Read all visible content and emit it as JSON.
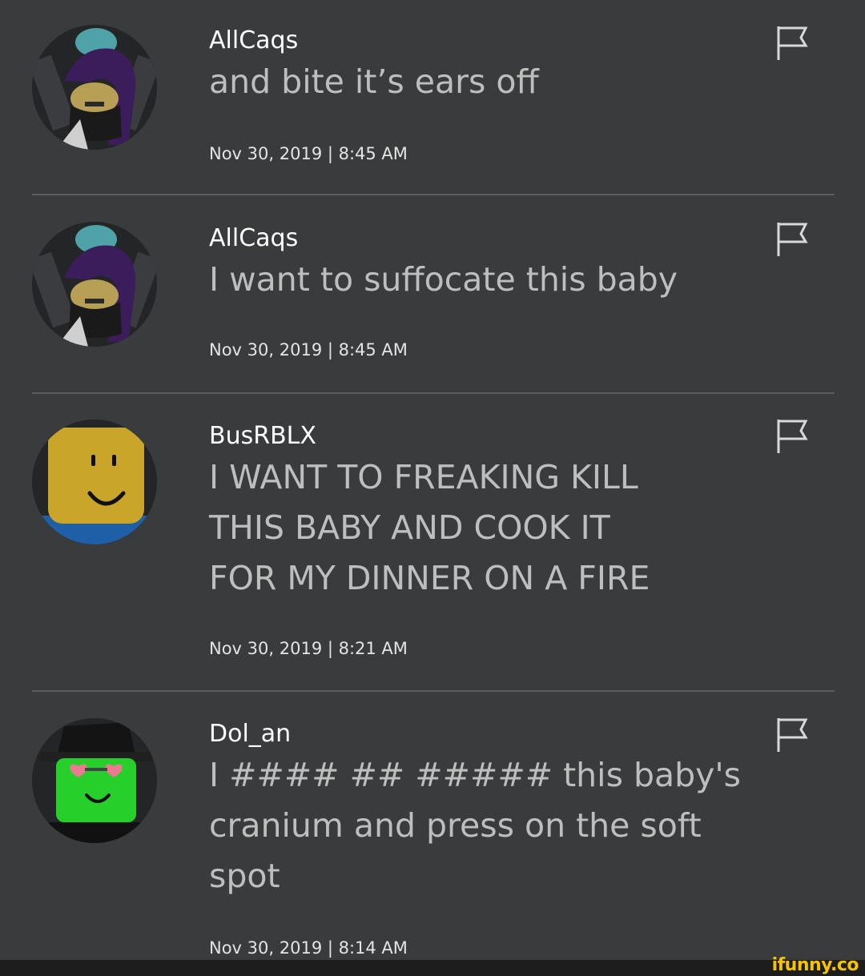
{
  "comments": [
    {
      "author": "AllCaqs",
      "body": "and bite it’s ears off",
      "timestamp": "Nov 30, 2019 | 8:45 AM",
      "avatar_icon": "purple-hair-masked-avatar-icon"
    },
    {
      "author": "AllCaqs",
      "body": "I want to suffocate this baby",
      "timestamp": "Nov 30, 2019 | 8:45 AM",
      "avatar_icon": "purple-hair-masked-avatar-icon"
    },
    {
      "author": "BusRBLX",
      "body": "I WANT TO FREAKING KILL\nTHIS BABY AND COOK IT\nFOR MY DINNER ON A FIRE",
      "timestamp": "Nov 30, 2019 | 8:21 AM",
      "avatar_icon": "yellow-smiley-avatar-icon"
    },
    {
      "author": "Dol_an",
      "body": "I #### ## ##### this baby's\ncranium and press on the soft\nspot",
      "timestamp": "Nov 30, 2019 | 8:14 AM",
      "avatar_icon": "green-heart-glasses-avatar-icon"
    }
  ],
  "flag_icon": "report-flag-icon",
  "watermark": "ifunny.co",
  "colors": {
    "background": "#393b3d",
    "author_text": "#ffffff",
    "body_text": "#bdbebe",
    "divider": "#5a5c5e",
    "watermark": "#f5c400"
  }
}
